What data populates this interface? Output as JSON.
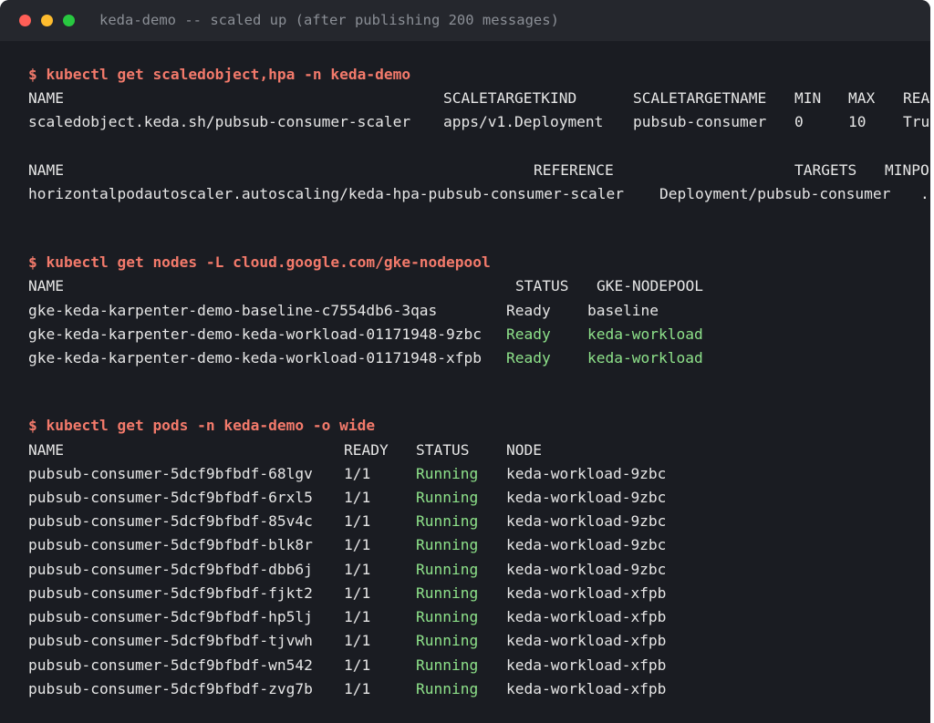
{
  "window": {
    "title": "keda-demo -- scaled up (after publishing 200 messages)",
    "colors": {
      "background": "#1a1c22",
      "titlebar": "#25272d",
      "prompt": "#f37a6b",
      "ok_green": "#8ee28a",
      "text": "#e6e6e6"
    }
  },
  "cmd1": {
    "prompt": "$ kubectl get scaledobject,hpa -n keda-demo",
    "so_headers": [
      "NAME",
      "SCALETARGETKIND",
      "SCALETARGETNAME",
      "MIN",
      "MAX",
      "REA"
    ],
    "so_row": [
      "scaledobject.keda.sh/pubsub-consumer-scaler",
      "apps/v1.Deployment",
      "pubsub-consumer",
      "0",
      "10",
      "Tru"
    ],
    "hpa_headers": [
      "NAME",
      "REFERENCE",
      "TARGETS",
      "MINPO"
    ],
    "hpa_row": [
      "horizontalpodautoscaler.autoscaling/keda-hpa-pubsub-consumer-scaler",
      "Deployment/pubsub-consumer",
      "."
    ]
  },
  "cmd2": {
    "prompt": "$ kubectl get nodes -L cloud.google.com/gke-nodepool",
    "headers": [
      "NAME",
      "STATUS",
      "GKE-NODEPOOL"
    ],
    "rows": [
      {
        "name": "gke-keda-karpenter-demo-baseline-c7554db6-3qas",
        "status": "Ready",
        "pool": "baseline"
      },
      {
        "name": "gke-keda-karpenter-demo-keda-workload-01171948-9zbc",
        "status": "Ready",
        "pool": "keda-workload"
      },
      {
        "name": "gke-keda-karpenter-demo-keda-workload-01171948-xfpb",
        "status": "Ready",
        "pool": "keda-workload"
      }
    ]
  },
  "cmd3": {
    "prompt": "$ kubectl get pods -n keda-demo -o wide",
    "headers": [
      "NAME",
      "READY",
      "STATUS",
      "NODE"
    ],
    "rows": [
      {
        "name": "pubsub-consumer-5dcf9bfbdf-68lgv",
        "ready": "1/1",
        "status": "Running",
        "node": "keda-workload-9zbc"
      },
      {
        "name": "pubsub-consumer-5dcf9bfbdf-6rxl5",
        "ready": "1/1",
        "status": "Running",
        "node": "keda-workload-9zbc"
      },
      {
        "name": "pubsub-consumer-5dcf9bfbdf-85v4c",
        "ready": "1/1",
        "status": "Running",
        "node": "keda-workload-9zbc"
      },
      {
        "name": "pubsub-consumer-5dcf9bfbdf-blk8r",
        "ready": "1/1",
        "status": "Running",
        "node": "keda-workload-9zbc"
      },
      {
        "name": "pubsub-consumer-5dcf9bfbdf-dbb6j",
        "ready": "1/1",
        "status": "Running",
        "node": "keda-workload-9zbc"
      },
      {
        "name": "pubsub-consumer-5dcf9bfbdf-fjkt2",
        "ready": "1/1",
        "status": "Running",
        "node": "keda-workload-xfpb"
      },
      {
        "name": "pubsub-consumer-5dcf9bfbdf-hp5lj",
        "ready": "1/1",
        "status": "Running",
        "node": "keda-workload-xfpb"
      },
      {
        "name": "pubsub-consumer-5dcf9bfbdf-tjvwh",
        "ready": "1/1",
        "status": "Running",
        "node": "keda-workload-xfpb"
      },
      {
        "name": "pubsub-consumer-5dcf9bfbdf-wn542",
        "ready": "1/1",
        "status": "Running",
        "node": "keda-workload-xfpb"
      },
      {
        "name": "pubsub-consumer-5dcf9bfbdf-zvg7b",
        "ready": "1/1",
        "status": "Running",
        "node": "keda-workload-xfpb"
      }
    ]
  }
}
